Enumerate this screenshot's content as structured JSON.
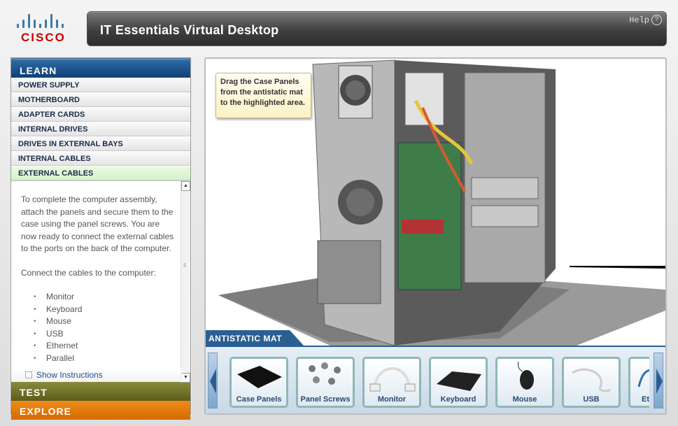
{
  "brand": {
    "logo_text": "CISCO"
  },
  "header": {
    "title": "IT Essentials Virtual Desktop",
    "help_label": "Help",
    "help_icon": "?"
  },
  "sidebar": {
    "learn_label": "LEARN",
    "items": [
      {
        "label": "POWER SUPPLY"
      },
      {
        "label": "MOTHERBOARD"
      },
      {
        "label": "ADAPTER CARDS"
      },
      {
        "label": "INTERNAL DRIVES"
      },
      {
        "label": "DRIVES IN EXTERNAL BAYS"
      },
      {
        "label": "INTERNAL CABLES"
      },
      {
        "label": "EXTERNAL CABLES",
        "active": true
      }
    ],
    "instructions": {
      "paragraph1": "To complete the computer assembly, attach the panels and secure them to the case using the panel screws. You are now ready to connect the external cables to the ports on the back of the computer.",
      "paragraph2": "Connect the cables to the computer:",
      "bullets": [
        "Monitor",
        "Keyboard",
        "Mouse",
        "USB",
        "Ethernet",
        "Parallel"
      ]
    },
    "show_instructions_label": "Show Instructions",
    "test_label": "TEST",
    "explore_label": "EXPLORE"
  },
  "stage": {
    "tooltip": "Drag the Case Panels from the antistatic mat to the highlighted area.",
    "mat_label": "ANTISTATIC MAT",
    "tiles": [
      {
        "label": "Case Panels",
        "icon": "case-panels-icon"
      },
      {
        "label": "Panel Screws",
        "icon": "panel-screws-icon"
      },
      {
        "label": "Monitor",
        "icon": "monitor-cable-icon"
      },
      {
        "label": "Keyboard",
        "icon": "keyboard-icon"
      },
      {
        "label": "Mouse",
        "icon": "mouse-icon"
      },
      {
        "label": "USB",
        "icon": "usb-cable-icon"
      },
      {
        "label": "Et",
        "icon": "ethernet-cable-icon"
      }
    ]
  },
  "colors": {
    "learn": "#1a4f88",
    "test": "#6f6f2a",
    "explore": "#e87a0c",
    "active_item": "#dcf5d0",
    "tile_border": "#8fb7b4"
  }
}
